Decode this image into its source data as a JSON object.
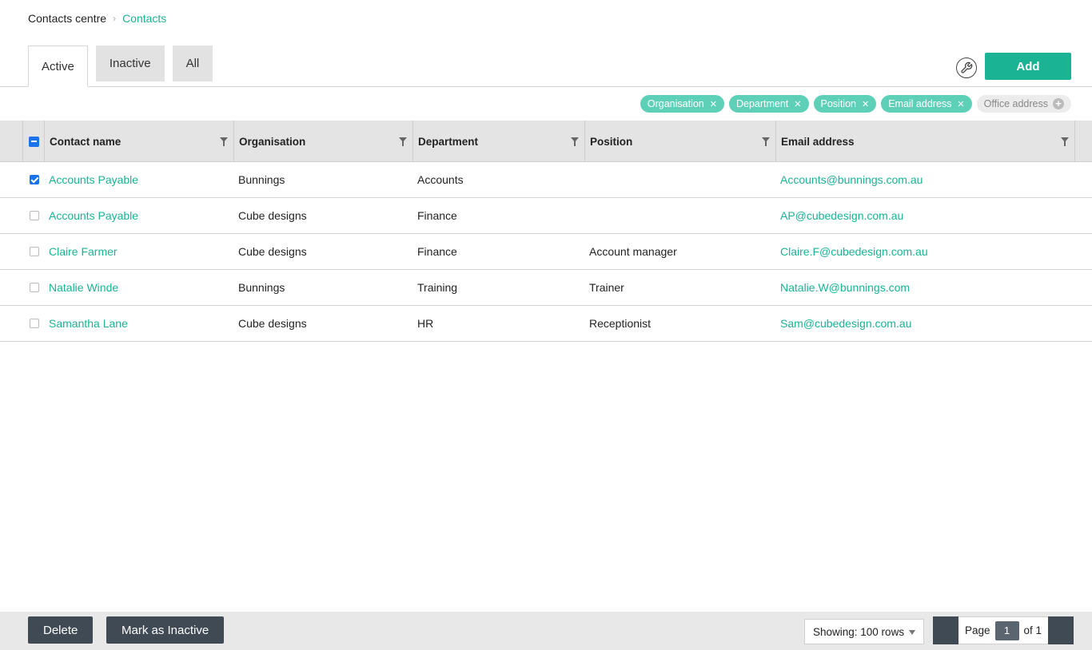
{
  "breadcrumb": {
    "root": "Contacts centre",
    "current": "Contacts"
  },
  "tabs": [
    {
      "label": "Active",
      "active": true
    },
    {
      "label": "Inactive",
      "active": false
    },
    {
      "label": "All",
      "active": false
    }
  ],
  "toolbar": {
    "add_label": "Add",
    "settings_icon": "wrench-icon"
  },
  "column_chips": [
    {
      "label": "Organisation",
      "enabled": true
    },
    {
      "label": "Department",
      "enabled": true
    },
    {
      "label": "Position",
      "enabled": true
    },
    {
      "label": "Email address",
      "enabled": true
    },
    {
      "label": "Office address",
      "enabled": false
    }
  ],
  "table": {
    "columns": [
      "Contact name",
      "Organisation",
      "Department",
      "Position",
      "Email address"
    ],
    "rows": [
      {
        "checked": true,
        "name": "Accounts Payable",
        "organisation": "Bunnings",
        "department": "Accounts",
        "position": "",
        "email": "Accounts@bunnings.com.au"
      },
      {
        "checked": false,
        "name": "Accounts Payable",
        "organisation": "Cube designs",
        "department": "Finance",
        "position": "",
        "email": "AP@cubedesign.com.au"
      },
      {
        "checked": false,
        "name": "Claire Farmer",
        "organisation": "Cube designs",
        "department": "Finance",
        "position": "Account manager",
        "email": "Claire.F@cubedesign.com.au"
      },
      {
        "checked": false,
        "name": "Natalie Winde",
        "organisation": "Bunnings",
        "department": "Training",
        "position": "Trainer",
        "email": "Natalie.W@bunnings.com"
      },
      {
        "checked": false,
        "name": "Samantha Lane",
        "organisation": "Cube designs",
        "department": "HR",
        "position": "Receptionist",
        "email": "Sam@cubedesign.com.au"
      }
    ]
  },
  "footer": {
    "delete_label": "Delete",
    "mark_inactive_label": "Mark as Inactive",
    "showing_label": "Showing: 100 rows",
    "page_label": "Page",
    "page_number": "1",
    "page_of": "of 1"
  },
  "colors": {
    "accent": "#1ab394",
    "dark_button": "#3f4a55",
    "checkbox": "#1a73e8"
  }
}
